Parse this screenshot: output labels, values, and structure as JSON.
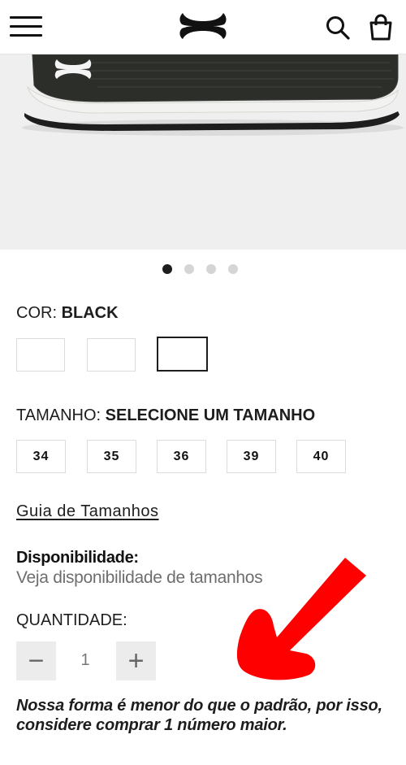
{
  "colors": {
    "arrow": "#ff0000",
    "selected_border": "#1d1d1d",
    "muted_text": "#6e6e6e"
  },
  "header": {
    "menu_icon": "hamburger-menu-icon",
    "logo": "under-armour-logo",
    "search_icon": "search-icon",
    "bag_icon": "shopping-bag-icon"
  },
  "carousel": {
    "total": 4,
    "active_index": 0
  },
  "color_option": {
    "label": "COR:",
    "value": "BLACK",
    "selected_index": 2
  },
  "size_option": {
    "label": "TAMANHO:",
    "value": "SELECIONE UM TAMANHO",
    "sizes": [
      "34",
      "35",
      "36",
      "39",
      "40"
    ]
  },
  "size_guide_link": "Guia de Tamanhos",
  "availability": {
    "title": "Disponibilidade:",
    "text": "Veja disponibilidade de tamanhos"
  },
  "quantity": {
    "label": "QUANTIDADE:",
    "value": "1",
    "decrement": "−",
    "increment": "+"
  },
  "note": "Nossa forma é menor do que o padrão, por isso, considere comprar 1 número maior."
}
